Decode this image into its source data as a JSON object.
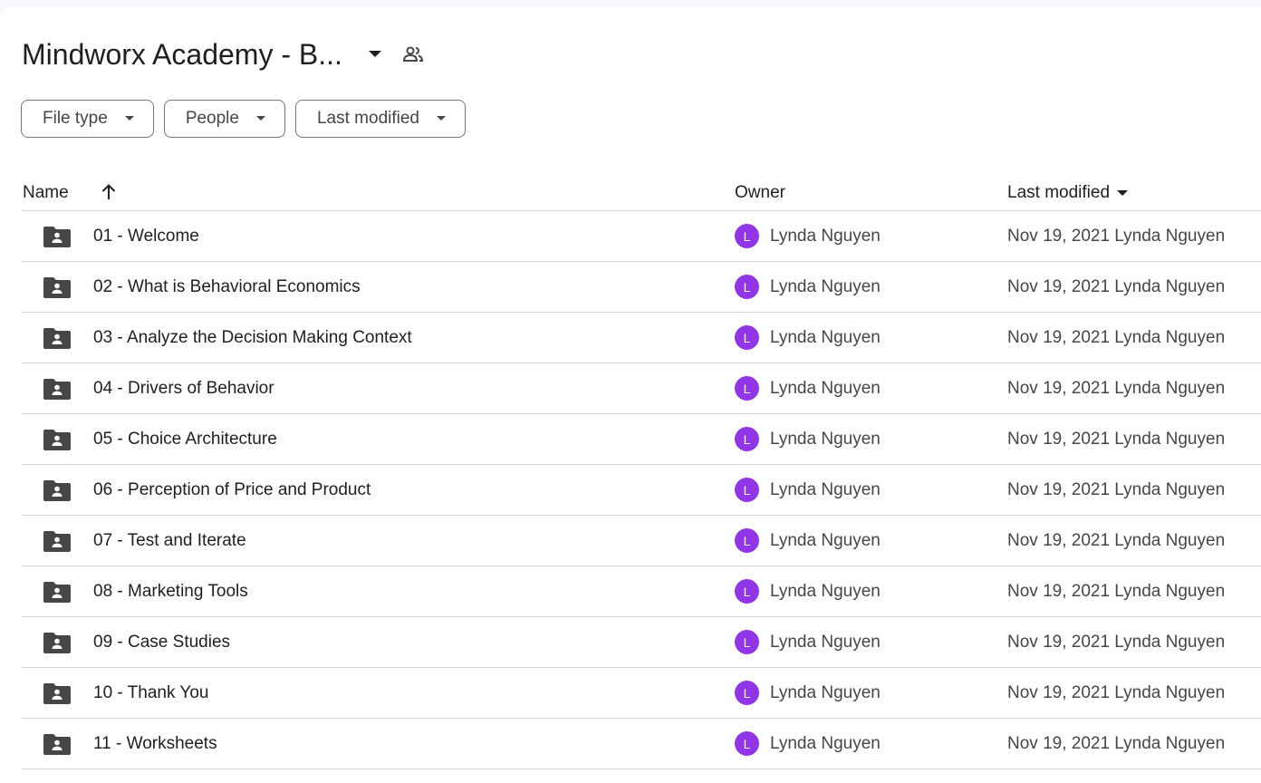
{
  "header": {
    "title": "Mindworx Academy - B...",
    "icons": {
      "title_caret": "dropdown-caret-icon",
      "shared": "shared-people-icon"
    }
  },
  "filters": [
    {
      "label": "File type"
    },
    {
      "label": "People"
    },
    {
      "label": "Last modified"
    }
  ],
  "columns": {
    "name": "Name",
    "owner": "Owner",
    "last_modified": "Last modified",
    "sort_direction": "ascending"
  },
  "colors": {
    "avatar": "#9334e6",
    "folder_icon": "#444746",
    "divider": "#dadce0"
  },
  "rows": [
    {
      "name": "01 - Welcome",
      "owner_initial": "L",
      "owner": "Lynda Nguyen",
      "modified": "Nov 19, 2021 Lynda Nguyen"
    },
    {
      "name": "02 - What is Behavioral Economics",
      "owner_initial": "L",
      "owner": "Lynda Nguyen",
      "modified": "Nov 19, 2021 Lynda Nguyen"
    },
    {
      "name": "03 - Analyze the Decision Making Context",
      "owner_initial": "L",
      "owner": "Lynda Nguyen",
      "modified": "Nov 19, 2021 Lynda Nguyen"
    },
    {
      "name": "04 - Drivers of Behavior",
      "owner_initial": "L",
      "owner": "Lynda Nguyen",
      "modified": "Nov 19, 2021 Lynda Nguyen"
    },
    {
      "name": "05 - Choice Architecture",
      "owner_initial": "L",
      "owner": "Lynda Nguyen",
      "modified": "Nov 19, 2021 Lynda Nguyen"
    },
    {
      "name": "06 - Perception of Price and Product",
      "owner_initial": "L",
      "owner": "Lynda Nguyen",
      "modified": "Nov 19, 2021 Lynda Nguyen"
    },
    {
      "name": "07 - Test and Iterate",
      "owner_initial": "L",
      "owner": "Lynda Nguyen",
      "modified": "Nov 19, 2021 Lynda Nguyen"
    },
    {
      "name": "08 - Marketing Tools",
      "owner_initial": "L",
      "owner": "Lynda Nguyen",
      "modified": "Nov 19, 2021 Lynda Nguyen"
    },
    {
      "name": "09 - Case Studies",
      "owner_initial": "L",
      "owner": "Lynda Nguyen",
      "modified": "Nov 19, 2021 Lynda Nguyen"
    },
    {
      "name": "10 - Thank You",
      "owner_initial": "L",
      "owner": "Lynda Nguyen",
      "modified": "Nov 19, 2021 Lynda Nguyen"
    },
    {
      "name": "11 - Worksheets",
      "owner_initial": "L",
      "owner": "Lynda Nguyen",
      "modified": "Nov 19, 2021 Lynda Nguyen"
    }
  ]
}
